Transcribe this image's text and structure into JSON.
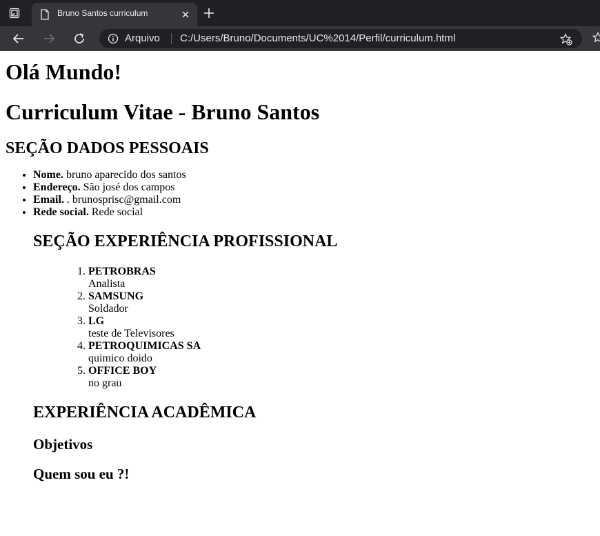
{
  "browser": {
    "tab_title": "Bruno Santos curriculum",
    "address_label": "Arquivo",
    "url": "C:/Users/Bruno/Documents/UC%2014/Perfil/curriculum.html",
    "icons": [
      "tab-actions-icon",
      "page-icon",
      "close-icon",
      "plus-icon",
      "back-icon",
      "forward-icon",
      "reload-icon",
      "info-icon",
      "add-favorite-icon",
      "favorites-icon"
    ]
  },
  "page": {
    "heading1": "Olá Mundo!",
    "heading2": "Curriculum Vitae - Bruno Santos",
    "personal_section": "SEÇÃO DADOS PESSOAIS",
    "personal": [
      {
        "label": "Nome.",
        "value": "bruno aparecido dos santos"
      },
      {
        "label": "Endereço.",
        "value": "São josé dos campos"
      },
      {
        "label": "Email.",
        "value": ". brunosprisc@gmail.com"
      },
      {
        "label": "Rede social.",
        "value": "Rede social"
      }
    ],
    "experience_section": "SEÇÃO EXPERIÊNCIA PROFISSIONAL",
    "experience": [
      {
        "company": "PETROBRAS",
        "role": "Analista"
      },
      {
        "company": "SAMSUNG",
        "role": "Soldador"
      },
      {
        "company": "LG",
        "role": "teste de Televisores"
      },
      {
        "company": "PETROQUIMICAS SA",
        "role": "quimico doido"
      },
      {
        "company": "OFFICE BOY",
        "role": "no grau"
      }
    ],
    "academic_section": "EXPERIÊNCIA ACADÊMICA",
    "objectives": "Objetivos",
    "about": "Quem sou eu ?!"
  }
}
